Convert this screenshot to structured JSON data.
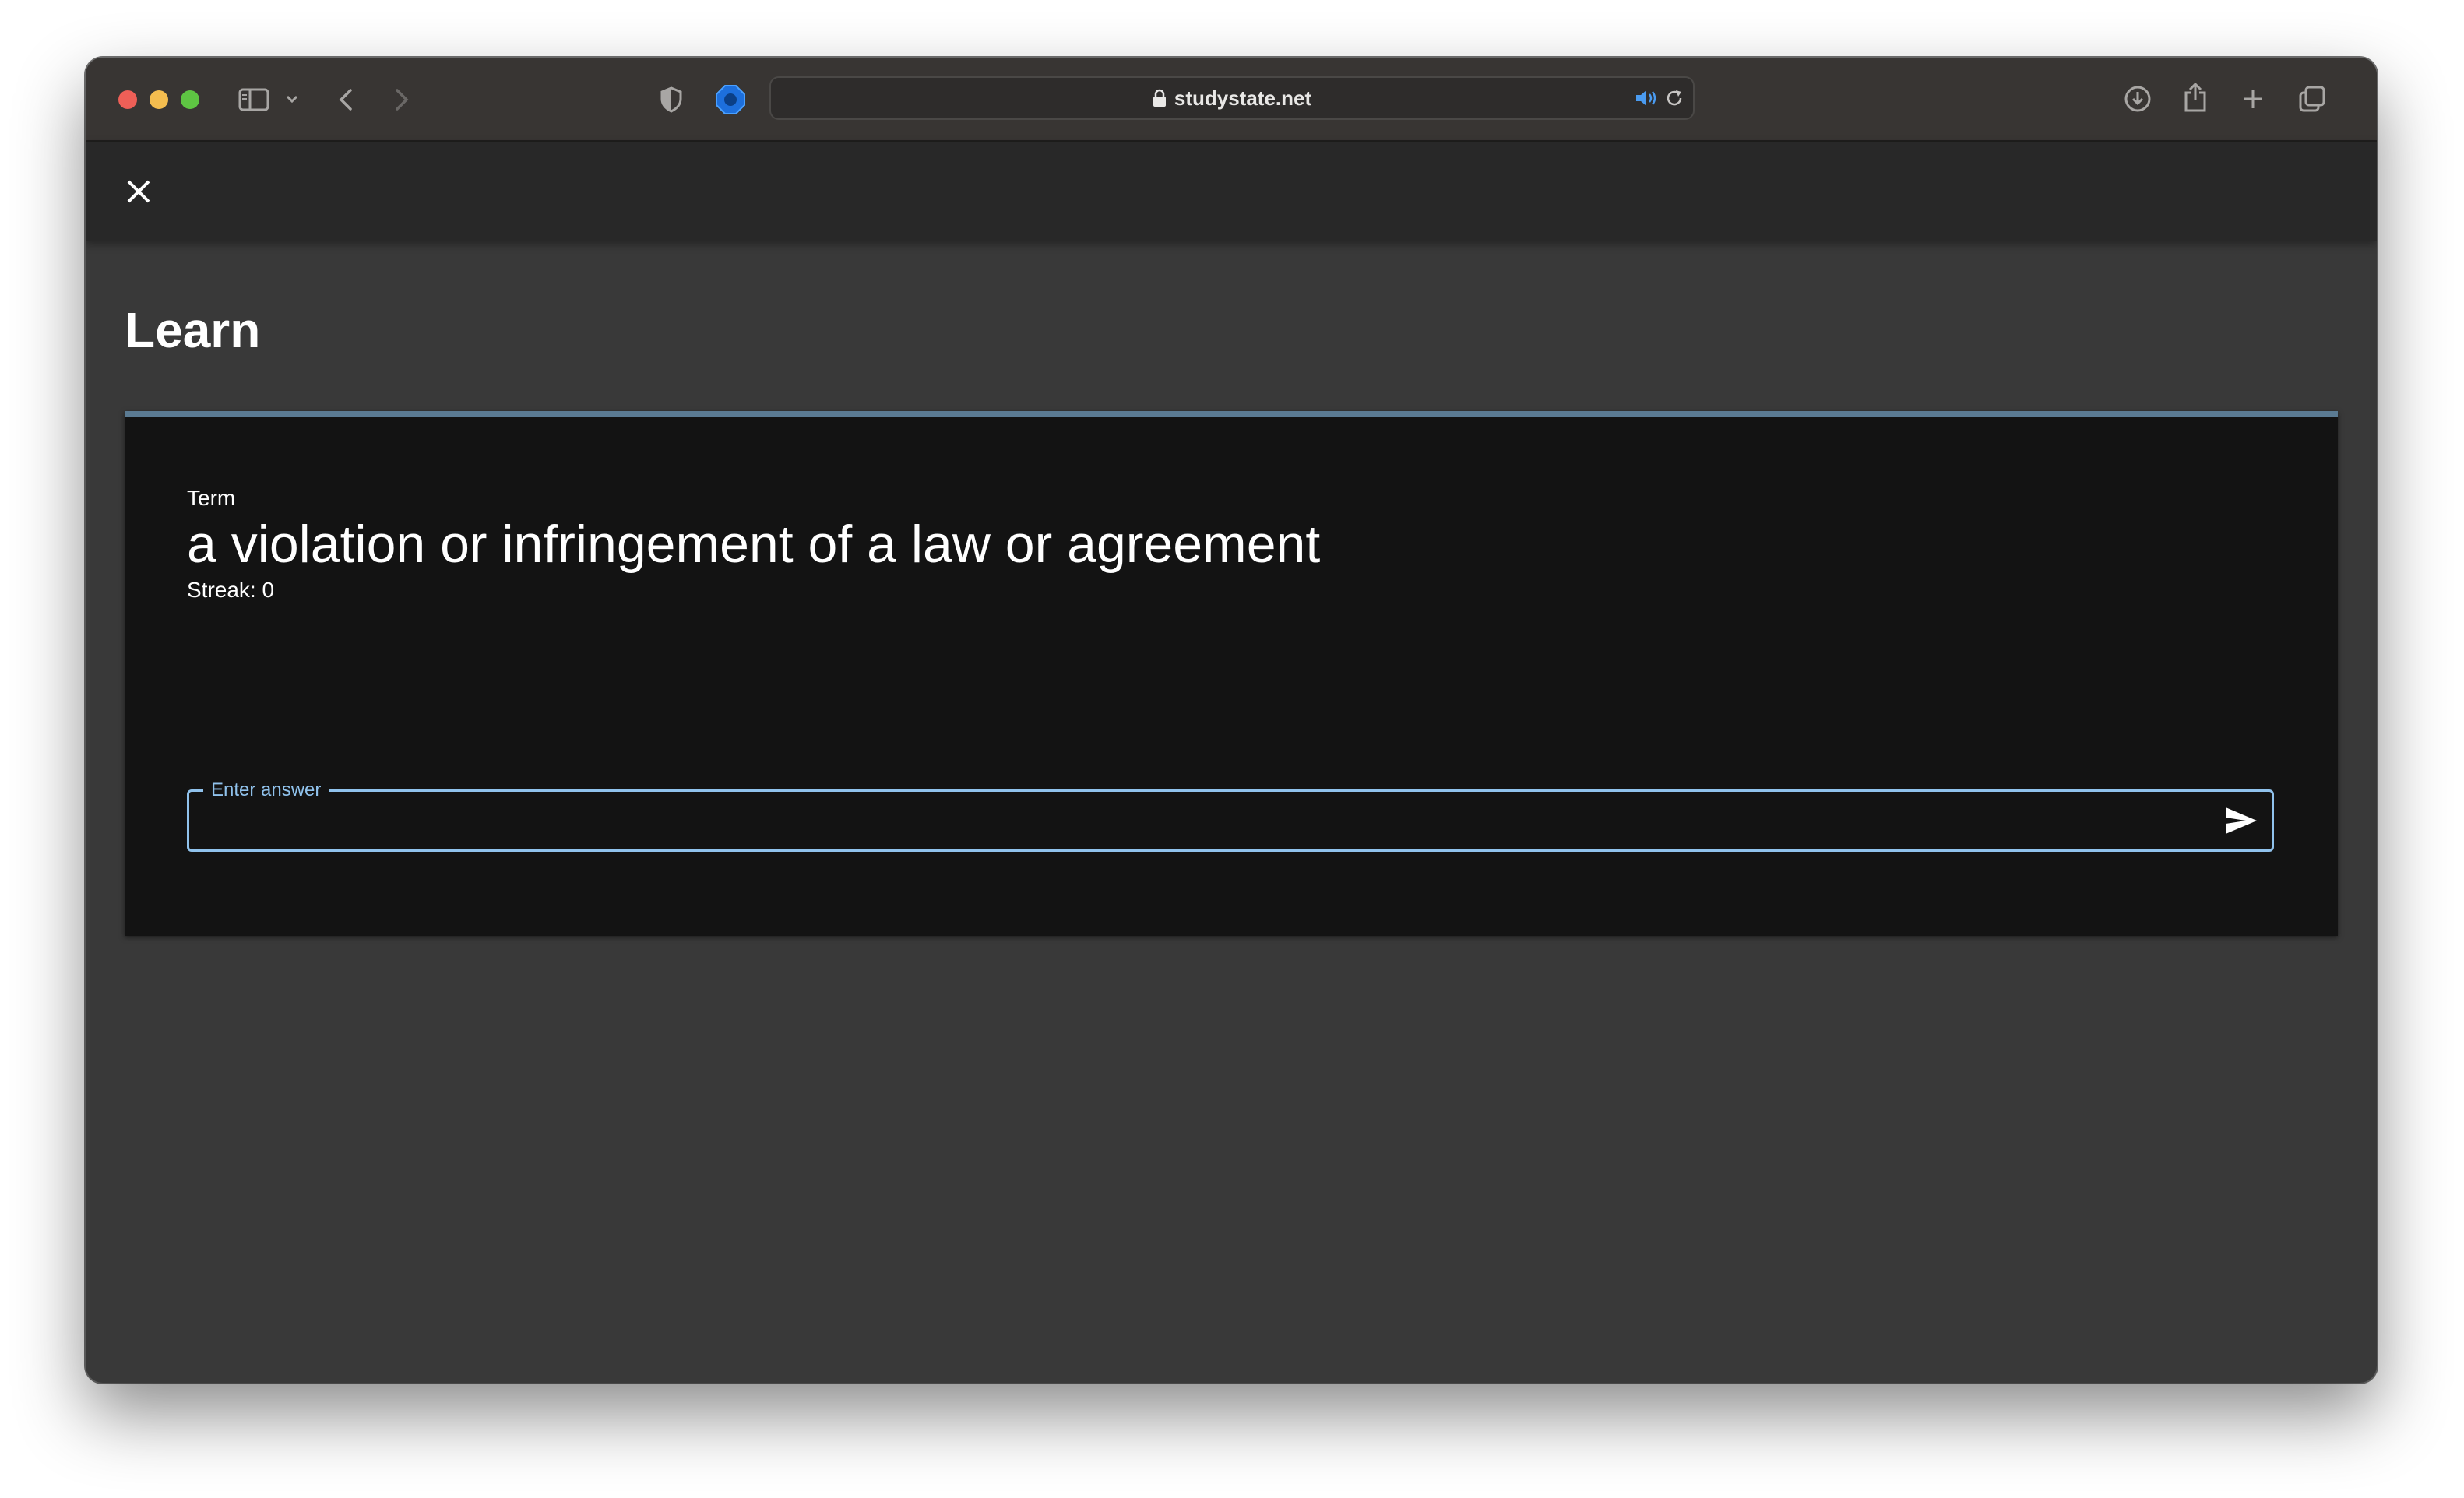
{
  "browser": {
    "url": "studystate.net",
    "icons": [
      "sidebar-icon",
      "chevron-down-icon",
      "back-icon",
      "forward-icon",
      "shield-icon",
      "extension-icon",
      "lock-icon",
      "speaker-icon",
      "reload-icon",
      "download-icon",
      "share-icon",
      "new-tab-icon",
      "tabs-overview-icon"
    ]
  },
  "header": {
    "close_icon": "close-icon"
  },
  "page": {
    "title": "Learn"
  },
  "card": {
    "term_label": "Term",
    "term_text": "a violation or infringement of a law or agreement",
    "streak": "Streak: 0",
    "answer_label": "Enter answer",
    "answer_value": "",
    "send_icon": "send-icon"
  },
  "colors": {
    "accent": "#90c2ec",
    "card_border": "#5b7b93",
    "background": "#393939",
    "card_background": "#131313"
  }
}
